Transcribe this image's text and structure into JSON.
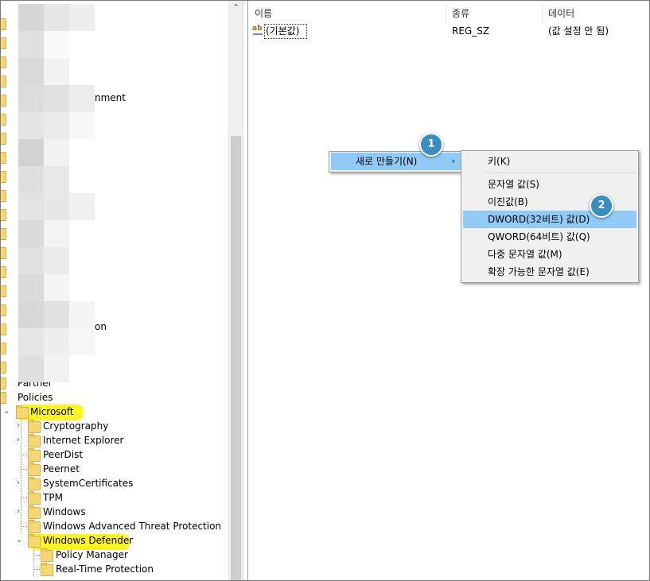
{
  "list": {
    "columns": [
      "이름",
      "종류",
      "데이터"
    ],
    "rows": [
      {
        "name": "(기본값)",
        "type": "REG_SZ",
        "data": "(값 설정 안 됨)"
      }
    ]
  },
  "tree": {
    "partial_labels": [
      "nment",
      "on"
    ],
    "items": [
      {
        "label": "Partner"
      },
      {
        "label": "Policies"
      },
      {
        "label": "Microsoft"
      },
      {
        "label": "Cryptography"
      },
      {
        "label": "Internet Explorer"
      },
      {
        "label": "PeerDist"
      },
      {
        "label": "Peernet"
      },
      {
        "label": "SystemCertificates"
      },
      {
        "label": "TPM"
      },
      {
        "label": "Windows"
      },
      {
        "label": "Windows Advanced Threat Protection"
      },
      {
        "label": "Windows Defender"
      },
      {
        "label": "Policy Manager"
      },
      {
        "label": "Real-Time Protection"
      }
    ]
  },
  "context_menu": {
    "new_label": "새로 만들기(N)",
    "submenu_arrow": "›"
  },
  "submenu": {
    "items": [
      "키(K)",
      "문자열 값(S)",
      "이진값(B)",
      "DWORD(32비트) 값(D)",
      "QWORD(64비트) 값(Q)",
      "다중 문자열 값(M)",
      "확장 가능한 문자열 값(E)"
    ]
  },
  "badges": [
    "1",
    "2"
  ],
  "colors": {
    "selection": "#91c9f7",
    "highlighter": "#fff200",
    "badge": "#3a8dc0",
    "folder": "#f7d774"
  },
  "icons": {
    "folder": "folder-icon",
    "value": "string-value-icon",
    "expand": "chevron-right-icon",
    "collapse": "chevron-down-icon"
  }
}
